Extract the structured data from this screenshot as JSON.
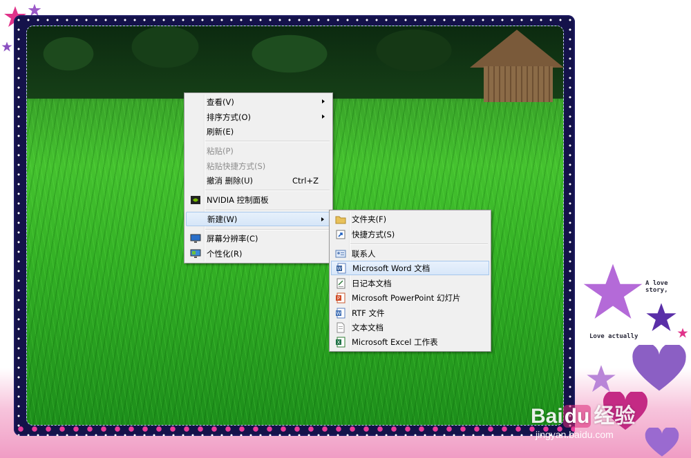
{
  "context_menu": {
    "items": [
      {
        "label": "查看(V)",
        "submenu": true
      },
      {
        "label": "排序方式(O)",
        "submenu": true
      },
      {
        "label": "刷新(E)"
      },
      {
        "label": "粘贴(P)",
        "disabled": true
      },
      {
        "label": "粘贴快捷方式(S)",
        "disabled": true
      },
      {
        "label": "撤消 删除(U)",
        "shortcut": "Ctrl+Z"
      },
      {
        "label": "NVIDIA 控制面板",
        "icon": "nvidia-icon"
      },
      {
        "label": "新建(W)",
        "submenu": true,
        "highlighted": true
      },
      {
        "label": "屏幕分辨率(C)",
        "icon": "display-icon"
      },
      {
        "label": "个性化(R)",
        "icon": "personalize-icon"
      }
    ]
  },
  "new_submenu": {
    "items": [
      {
        "label": "文件夹(F)",
        "icon": "folder-icon"
      },
      {
        "label": "快捷方式(S)",
        "icon": "shortcut-icon"
      },
      {
        "label": "联系人",
        "icon": "contact-icon"
      },
      {
        "label": "Microsoft Word 文档",
        "icon": "word-icon",
        "hover": true
      },
      {
        "label": "日记本文档",
        "icon": "journal-icon"
      },
      {
        "label": "Microsoft PowerPoint 幻灯片",
        "icon": "powerpoint-icon"
      },
      {
        "label": "RTF 文件",
        "icon": "rtf-icon"
      },
      {
        "label": "文本文档",
        "icon": "text-file-icon"
      },
      {
        "label": "Microsoft Excel 工作表",
        "icon": "excel-icon"
      }
    ]
  },
  "decor": {
    "love_story": "A love story,",
    "love_actually": "Love actually"
  },
  "watermark": {
    "brand": "Bai",
    "brand_du": "du",
    "brand_jingyan": "经验",
    "url": "jingyan.baidu.com"
  },
  "colors": {
    "frame": "#14124a",
    "menu_bg": "#f0f0f0",
    "highlight": "#d6e6f8"
  }
}
